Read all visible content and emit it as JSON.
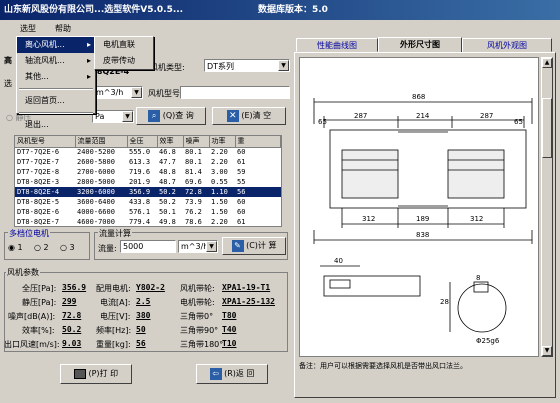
{
  "titlebar": {
    "title": "山东新风股份有限公司...选型软件V5.0.5...",
    "db_version": "数据库版本：5.0"
  },
  "menubar": {
    "items": [
      "选型",
      "帮助"
    ]
  },
  "menu_xuanxing": {
    "items": [
      "离心风机...",
      "轴流风机...",
      "其他...",
      "返回首页...",
      "退出..."
    ]
  },
  "submenu": {
    "items": [
      "电机直联",
      "皮带传动"
    ]
  },
  "form": {
    "model_partial": "8-8Q2E-4",
    "fan_type_label": "风机类型:",
    "fan_type_value": "DT系列",
    "unit_value": "m^3/h",
    "fan_model_label": "风机型号:",
    "pa_value": "Pa",
    "static_label": "静压",
    "query_button": "(Q)查 询",
    "clear_button": "(E)清 空"
  },
  "table": {
    "headers": [
      "风机型号",
      "流量范围",
      "全压",
      "效率",
      "噪声",
      "功率",
      "重"
    ],
    "rows": [
      [
        "DT7-7Q2E-6",
        "2400-5200",
        "555.0",
        "46.8",
        "80.1",
        "2.20",
        "60"
      ],
      [
        "DT7-7Q2E-7",
        "2600-5800",
        "613.3",
        "47.7",
        "80.1",
        "2.20",
        "61"
      ],
      [
        "DT7-7Q2E-8",
        "2700-6000",
        "719.6",
        "48.8",
        "81.4",
        "3.00",
        "59"
      ],
      [
        "DT8-8Q2E-3",
        "2800-5000",
        "201.9",
        "48.7",
        "69.6",
        "0.55",
        "55"
      ],
      [
        "DT8-8Q2E-4",
        "3200-6000",
        "356.9",
        "50.2",
        "72.8",
        "1.10",
        "56"
      ],
      [
        "DT8-8Q2E-5",
        "3600-6400",
        "433.8",
        "50.2",
        "73.9",
        "1.50",
        "60"
      ],
      [
        "DT8-8Q2E-6",
        "4000-6600",
        "576.1",
        "50.1",
        "76.2",
        "1.50",
        "60"
      ],
      [
        "DT8-8Q2E-7",
        "4600-7000",
        "779.4",
        "49.8",
        "78.6",
        "2.20",
        "61"
      ]
    ]
  },
  "motor": {
    "group_label": "多档位电机",
    "options": [
      "1",
      "2",
      "3"
    ]
  },
  "flowcalc": {
    "group_label": "流量计算",
    "flow_label": "流量:",
    "flow_value": "5000",
    "unit": "m^3/h",
    "calc_button": "(C)计 算"
  },
  "params": {
    "group_label": "风机参数",
    "quanya_label": "全压[Pa]:",
    "quanya_value": "356.9",
    "peidian_label": "配用电机:",
    "peidian_value": "Y802-2",
    "fengjidailun_label": "风机带轮:",
    "fengjidailun_value": "XPA1-19-T1",
    "jingya_label": "静压[Pa]:",
    "jingya_value": "299",
    "dianliu_label": "电流[A]:",
    "dianliu_value": "2.5",
    "dianjidailun_label": "电机带轮:",
    "dianjidailun_value": "XPA1-25-132",
    "zaosheng_label": "噪声[dB(A)]:",
    "zaosheng_value": "72.8",
    "dianya_label": "电压[V]:",
    "dianya_value": "380",
    "sanjiao0_label": "三角带0°",
    "sanjiao0_value": "T80",
    "xiaolv_label": "效率[%]:",
    "xiaolv_value": "50.2",
    "pinlv_label": "频率[Hz]:",
    "pinlv_value": "50",
    "sanjiao90_label": "三角带90°",
    "sanjiao90_value": "T40",
    "chukou_label": "出口风速[m/s]:",
    "chukou_value": "9.03",
    "zhongliang_label": "重量[kg]:",
    "zhongliang_value": "56",
    "sanjiao180_label": "三角带180°",
    "sanjiao180_value": "T10"
  },
  "bottom": {
    "print_button": "(P)打 印",
    "back_button": "(R)返 回"
  },
  "tabs": {
    "items": [
      "性能曲线图",
      "外形尺寸图",
      "风机外观图"
    ]
  },
  "drawing": {
    "dims": [
      "868",
      "287",
      "214",
      "287",
      "65",
      "65",
      "312",
      "189",
      "312",
      "838",
      "40",
      "28",
      "8",
      "Φ25g6"
    ],
    "note": "备注：用户可以根据需要选择风机是否带出风口法兰。"
  }
}
